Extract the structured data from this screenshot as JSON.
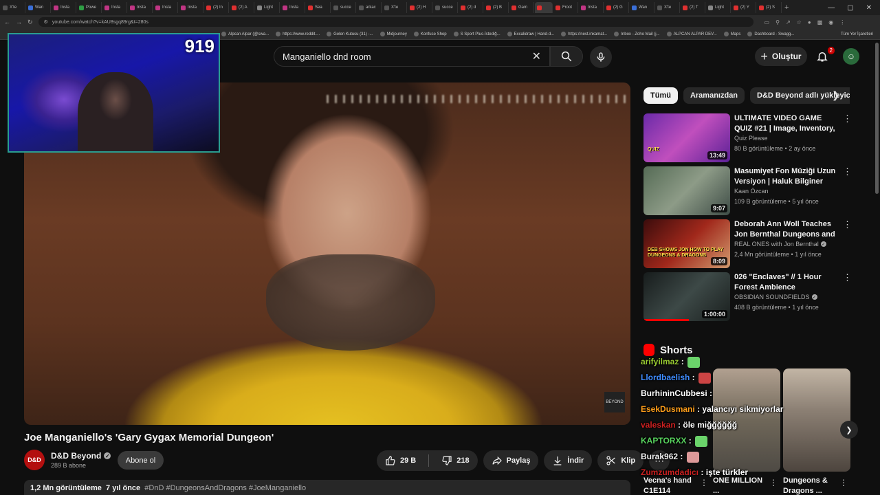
{
  "browser": {
    "tabs": [
      "X'te",
      "Wan",
      "Insta",
      "Powe",
      "Insta",
      "Insta",
      "Insta",
      "Insta",
      "(2) In",
      "(2) A",
      "Light",
      "Insta",
      "Sea",
      "succe",
      "arkac",
      "X'te",
      "(2) H",
      "succe",
      "(2) d",
      "(2) B",
      "Gam",
      "",
      "Froot",
      "Insta",
      "(2) G",
      "Wan",
      "X'te",
      "(2) T",
      "Light",
      "(2) Y",
      "(2) S"
    ],
    "address": "youtube.com/watch?v=kAU8sgq89rg&t=280s",
    "bookmarks": [
      "Alpcan Alpar (@swa...",
      "https://www.reddit....",
      "Gelen Kutusu (31) -...",
      "Midjourney",
      "Konfuse Shop",
      "S Sport Plus-İstediğ...",
      "Excalidraw | Hand-d...",
      "https://nest.inkamat...",
      "Inbox - Zoho Mail (j...",
      "ALPCAN ALPAR DEV...",
      "Maps",
      "Dashboard - Swagg..."
    ],
    "bookmarks_right": "Tüm Yer İşaretleri"
  },
  "header": {
    "search_query": "Manganiello  dnd room",
    "create_label": "Oluştur",
    "notification_count": "2"
  },
  "overlay": {
    "viewer_count": "919"
  },
  "video": {
    "title": "Joe Manganiello's 'Gary Gygax Memorial Dungeon'",
    "channel": "D&D Beyond",
    "channel_avatar_text": "D&D",
    "subscribers": "289 B abone",
    "subscribe_label": "Abone ol",
    "likes": "29 B",
    "dislikes": "218",
    "share_label": "Paylaş",
    "download_label": "İndir",
    "clip_label": "Klip",
    "views": "1,2 Mn görüntüleme",
    "age": "7 yıl önce",
    "tags": "#DnD #DungeonsAndDragons #JoeManganiello",
    "brand_watermark": "BEYOND"
  },
  "sidebar": {
    "chips": [
      "Tümü",
      "Aramanızdan",
      "D&D Beyond adlı yükleyiciden"
    ],
    "recommendations": [
      {
        "title": "ULTIMATE VIDEO GAME QUIZ #21 | Image, Inventory, Loadin...",
        "channel": "Quiz Please",
        "verified": false,
        "meta": "80 B görüntüleme • 2 ay önce",
        "duration": "13:49",
        "thumb_text": "QUIZ",
        "progress": 0
      },
      {
        "title": "Masumiyet Fon Müziği Uzun Versiyon | Haluk Bilginer Tirad",
        "channel": "Kaan Özcan",
        "verified": false,
        "meta": "109 B görüntüleme • 5 yıl önce",
        "duration": "9:07",
        "thumb_text": "",
        "progress": 0
      },
      {
        "title": "Deborah Ann Woll Teaches Jon Bernthal Dungeons and Dragons",
        "channel": "REAL ONES with Jon Bernthal",
        "verified": true,
        "meta": "2,4 Mn görüntüleme • 1 yıl önce",
        "duration": "8:09",
        "thumb_text": "DEB SHOWS JON HOW TO PLAY DUNGEONS & DRAGONS",
        "progress": 0
      },
      {
        "title": "026 \"Enclaves\" // 1 Hour Forest Ambience",
        "channel": "OBSIDIAN SOUNDFIELDS",
        "verified": true,
        "meta": "408 B görüntüleme • 1 yıl önce",
        "duration": "1:00:00",
        "thumb_text": "",
        "progress": 0.52
      }
    ],
    "shorts_heading": "Shorts",
    "shorts": [
      {
        "title": "ONE MILLION ..."
      },
      {
        "title": "Dungeons & Dragons ..."
      }
    ],
    "shorts_partial_title": "Vecna's hand C1E114"
  },
  "chat": [
    {
      "user": "arifyilmaz",
      "message": "",
      "color": "#9acd32",
      "emote": "#6ad36a"
    },
    {
      "user": "Llordbaelish",
      "message": "",
      "color": "#3f8cff",
      "emote": "#c44"
    },
    {
      "user": "BurhininCubbesi",
      "message": "",
      "color": "#ffffff",
      "emote": ""
    },
    {
      "user": "EsekDusmani",
      "message": "yalancıyı sikmiyorlar",
      "color": "#ff9f1a",
      "emote": ""
    },
    {
      "user": "valeskan",
      "message": "öle miğğğğğğ",
      "color": "#cc2020",
      "emote": ""
    },
    {
      "user": "KAPTORXX",
      "message": "",
      "color": "#58d35e",
      "emote": "#6ad36a"
    },
    {
      "user": "Burak962",
      "message": "",
      "color": "#f1f1f1",
      "emote": "#d99"
    },
    {
      "user": "Zumzumdadicı",
      "message": "işte türkler",
      "color": "#cc2020",
      "emote": ""
    }
  ],
  "colors": {
    "background": "#0f0f0f",
    "accent_red": "#ff0000",
    "pill_bg": "#272727"
  }
}
